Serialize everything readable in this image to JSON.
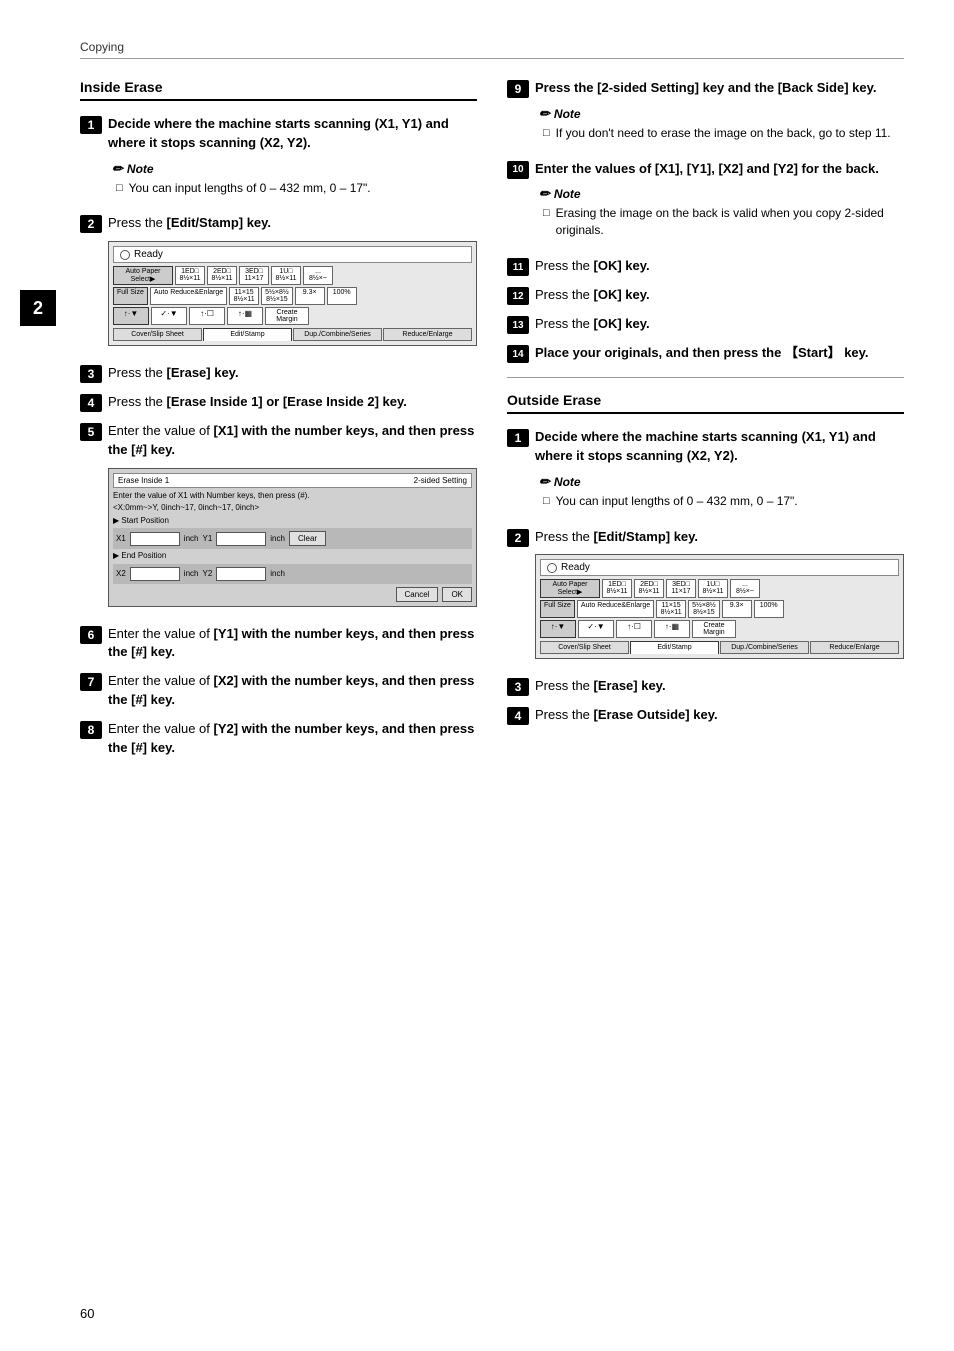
{
  "page": {
    "top_label": "Copying",
    "page_number": "60",
    "chapter_badge": "2"
  },
  "inside_erase": {
    "title": "Inside Erase",
    "steps": [
      {
        "num": "1",
        "text": "Decide where the machine starts scanning (X1, Y1) and where it stops scanning (X2, Y2).",
        "note": {
          "title": "Note",
          "items": [
            "You can input lengths of 0 – 432 mm, 0 – 17\"."
          ]
        }
      },
      {
        "num": "2",
        "text": "Press the [Edit/Stamp] key."
      },
      {
        "num": "3",
        "text": "Press the [Erase] key."
      },
      {
        "num": "4",
        "text": "Press the [Erase Inside 1] or [Erase Inside 2] key."
      },
      {
        "num": "5",
        "text": "Enter the value of [X1] with the number keys, and then press the [#] key."
      },
      {
        "num": "6",
        "text": "Enter the value of [Y1] with the number keys, and then press the [#] key."
      },
      {
        "num": "7",
        "text": "Enter the value of [X2] with the number keys, and then press the [#] key."
      },
      {
        "num": "8",
        "text": "Enter the value of [Y2] with the number keys, and then press the [#] key."
      },
      {
        "num": "9",
        "text": "Press the [2-sided Setting] key and the [Back Side] key.",
        "note": {
          "title": "Note",
          "items": [
            "If you don't need to erase the image on the back, go to step 11."
          ]
        }
      },
      {
        "num": "10",
        "text": "Enter the values of [X1], [Y1], [X2] and [Y2] for the back.",
        "note": {
          "title": "Note",
          "items": [
            "Erasing the image on the back is valid when you copy 2-sided originals."
          ]
        }
      },
      {
        "num": "11",
        "text": "Press the [OK] key."
      },
      {
        "num": "12",
        "text": "Press the [OK] key."
      },
      {
        "num": "13",
        "text": "Press the [OK] key."
      },
      {
        "num": "14",
        "text": "Place your originals, and then press the 【Start】 key."
      }
    ],
    "screen1": {
      "header": "Ready",
      "paper_row": [
        "Auto Paper Select▶",
        "1ED□ 8½×11",
        "2ED□ 8½×11",
        "3ED□ 11×17",
        "1U□ 8½×11",
        "...  8½×~"
      ],
      "size_row": [
        "Full Size",
        "Auto Reduce&Enlarge",
        "11×15 8½×11",
        "5½×8½ 8½×15",
        "9.3×",
        "100%"
      ],
      "icon_row": [
        "[↑·▼]",
        "[✓·▼]",
        "[↑·☐]",
        "[↑·▦]",
        "Create Margin"
      ],
      "tabs": [
        "Cover/Slip Sheet",
        "Edit/Stamp",
        "Dup./Combine/Series",
        "Reduce/Enlarge"
      ]
    },
    "screen2": {
      "header_left": "Erase Inside 1",
      "header_right": "2-sided Setting",
      "info_lines": [
        "Enter the value of X1 with Number keys, then press (#).",
        "<X:0mm~>Y, 0inch~17, 0inch~17, 0inch>",
        "▶ Start Position"
      ],
      "x1_label": "X1",
      "x1_unit": "inch",
      "y1_label": "Y1",
      "y1_unit": "inch",
      "clear_label": "Clear",
      "end_position": "▶ End Position",
      "x2_label": "X2",
      "x2_unit": "inch",
      "y2_label": "Y2",
      "y2_unit": "inch",
      "cancel_label": "Cancel",
      "ok_label": "OK"
    }
  },
  "outside_erase": {
    "title": "Outside Erase",
    "steps": [
      {
        "num": "1",
        "text": "Decide where the machine starts scanning (X1, Y1) and where it stops scanning (X2, Y2).",
        "note": {
          "title": "Note",
          "items": [
            "You can input lengths of 0 – 432 mm, 0 – 17\"."
          ]
        }
      },
      {
        "num": "2",
        "text": "Press the [Edit/Stamp] key."
      },
      {
        "num": "3",
        "text": "Press the [Erase] key."
      },
      {
        "num": "4",
        "text": "Press the [Erase Outside] key."
      }
    ],
    "screen1": {
      "header": "Ready",
      "paper_row": [
        "Auto Paper Select▶",
        "1ED□ 8½×11",
        "2ED□ 8½×11",
        "3ED□ 11×17",
        "1U□ 8½×11",
        "...  8½×~"
      ],
      "size_row": [
        "Full Size",
        "Auto Reduce&Enlarge",
        "11×15 8½×11",
        "5½×8½ 8½×15",
        "9.3×",
        "100%"
      ],
      "icon_row": [
        "[↑·▼]",
        "[✓·▼]",
        "[↑·☐]",
        "[↑·▦]",
        "Create Margin"
      ],
      "tabs": [
        "Cover/Slip Sheet",
        "Edit/Stamp",
        "Dup./Combine/Series",
        "Reduce/Enlarge"
      ]
    }
  }
}
